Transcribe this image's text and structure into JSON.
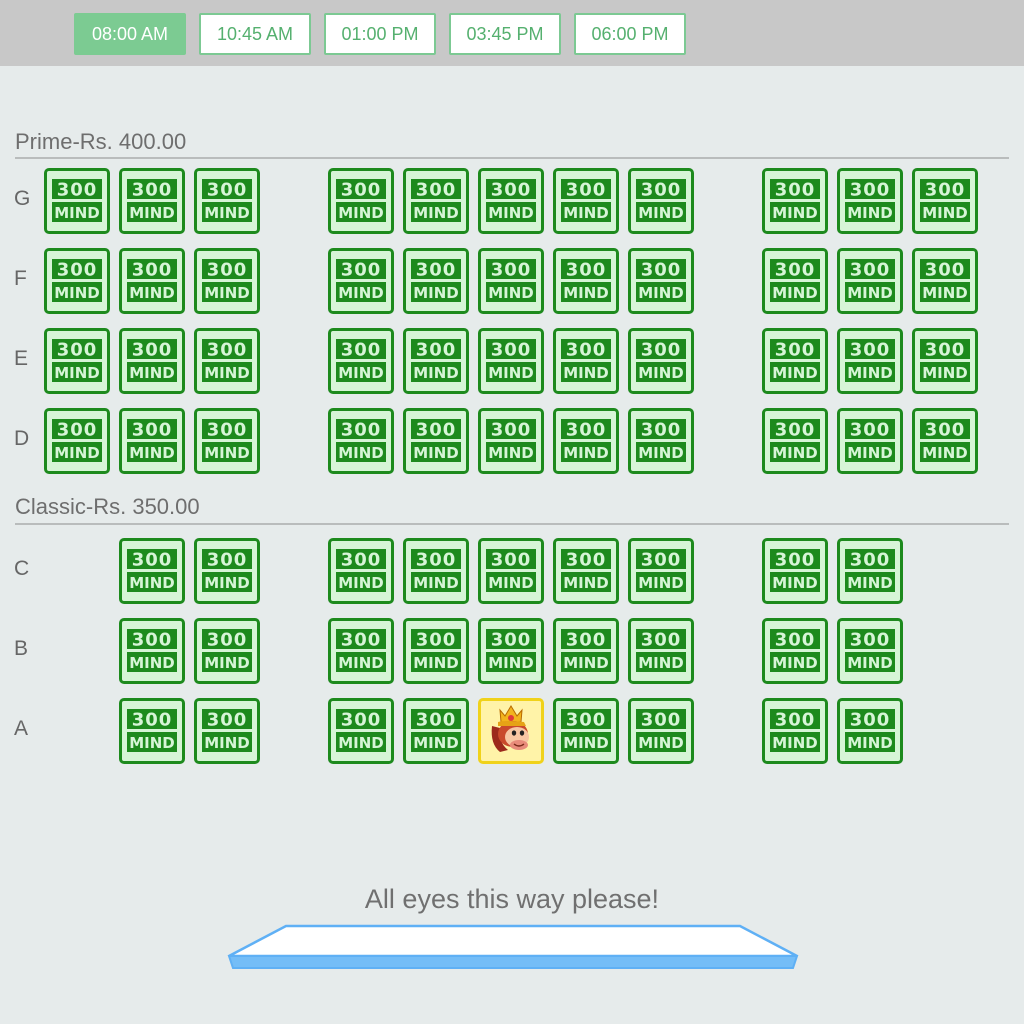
{
  "showtimes": [
    {
      "label": "08:00 AM",
      "active": true
    },
    {
      "label": "10:45 AM",
      "active": false
    },
    {
      "label": "01:00 PM",
      "active": false
    },
    {
      "label": "03:45 PM",
      "active": false
    },
    {
      "label": "06:00 PM",
      "active": false
    }
  ],
  "sections": [
    {
      "title": "Prime-Rs. 400.00"
    },
    {
      "title": "Classic-Rs. 350.00"
    }
  ],
  "rows": [
    {
      "label": "G"
    },
    {
      "label": "F"
    },
    {
      "label": "E"
    },
    {
      "label": "D"
    },
    {
      "label": "C"
    },
    {
      "label": "B"
    },
    {
      "label": "A"
    }
  ],
  "seat_icon": {
    "line1": "300",
    "line2": "MIND"
  },
  "selected_seat": {
    "row": "A",
    "seat_index": 4,
    "icon": "monkey-avatar-icon"
  },
  "screen": {
    "label": "All eyes this way please!"
  },
  "colors": {
    "topbar": "#c8c8c8",
    "active_time": "#7ccb92",
    "seat_border": "#1d8a1d",
    "seat_fill": "#d6f5d6",
    "selected_border": "#f0d21a",
    "screen_blue": "#5fb0f5"
  }
}
